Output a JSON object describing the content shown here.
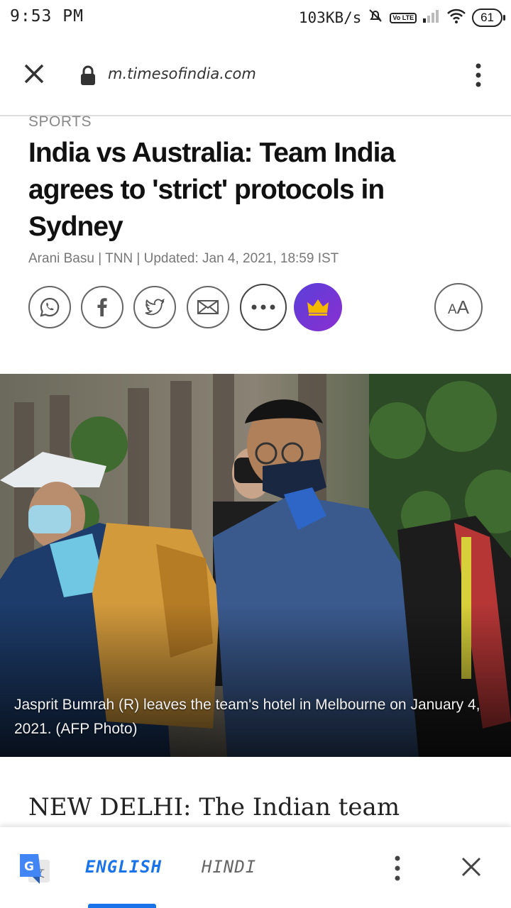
{
  "status_bar": {
    "time": "9:53 PM",
    "speed": "103KB/s",
    "volte": "Vo LTE",
    "battery": "61"
  },
  "browser": {
    "url": "m.timesofindia.com"
  },
  "article": {
    "section": "SPORTS",
    "headline": "India vs Australia: Team India agrees to 'strict' protocols in Sydney",
    "byline": "Arani Basu | TNN | Updated: Jan 4, 2021, 18:59 IST",
    "font_size_label_small": "A",
    "font_size_label_large": "A",
    "photo_caption": "Jasprit Bumrah (R) leaves the team's hotel in Melbourne on January 4, 2021. (AFP Photo)",
    "lede": "NEW DELHI: The Indian team"
  },
  "translate_bar": {
    "active_language": "ENGLISH",
    "other_language": "HINDI"
  },
  "colors": {
    "accent_blue": "#1a73e8",
    "premium_purple": "#6a3bd6",
    "crown_gold": "#f5b800"
  }
}
